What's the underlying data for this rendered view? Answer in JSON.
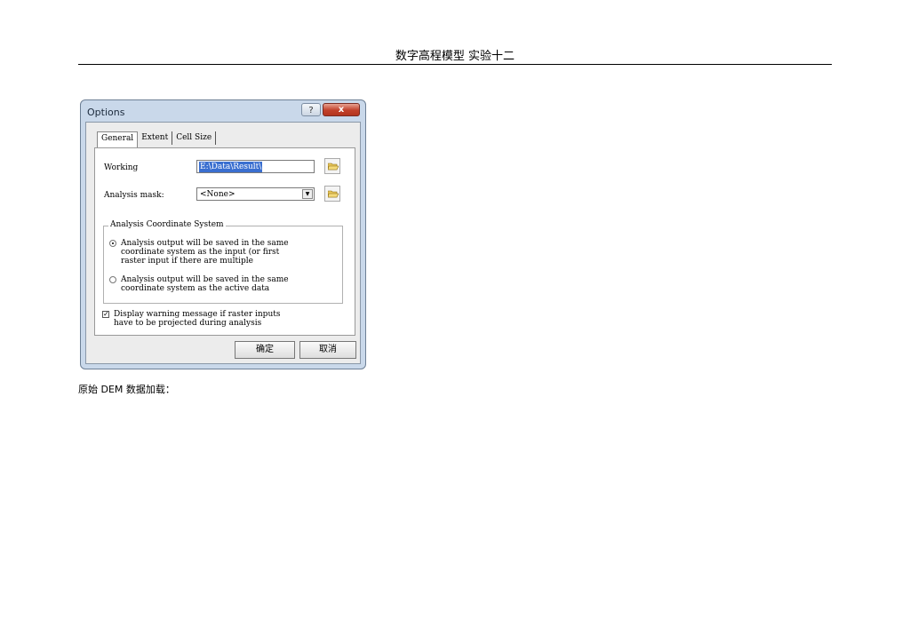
{
  "page": {
    "header": "数字高程模型 实验十二",
    "caption": "原始 DEM 数据加载："
  },
  "dialog": {
    "title": "Options",
    "help_label": "?",
    "close_label": "x",
    "tabs": [
      "General",
      "Extent",
      "Cell Size"
    ],
    "active_tab": "General",
    "working": {
      "label": "Working",
      "value": "E:\\Data\\Result\\"
    },
    "analysis_mask": {
      "label": "Analysis mask:",
      "value": "<None>"
    },
    "coordinate_group": {
      "label": "Analysis Coordinate System",
      "option1": "Analysis output will be saved in the same\ncoordinate system as the input (or first\nraster input if there are multiple",
      "option2": "Analysis output will be saved in the same\ncoordinate system as the active data",
      "selected": 1
    },
    "warning_checkbox": {
      "label": "Display warning message if raster inputs\nhave to be projected during analysis",
      "checked": true,
      "mark": "✓"
    },
    "ok_label": "确定",
    "cancel_label": "取消"
  },
  "colors": {
    "frame": "#c9d8ea",
    "close": "#c1402a",
    "selection": "#3a6fd0"
  }
}
